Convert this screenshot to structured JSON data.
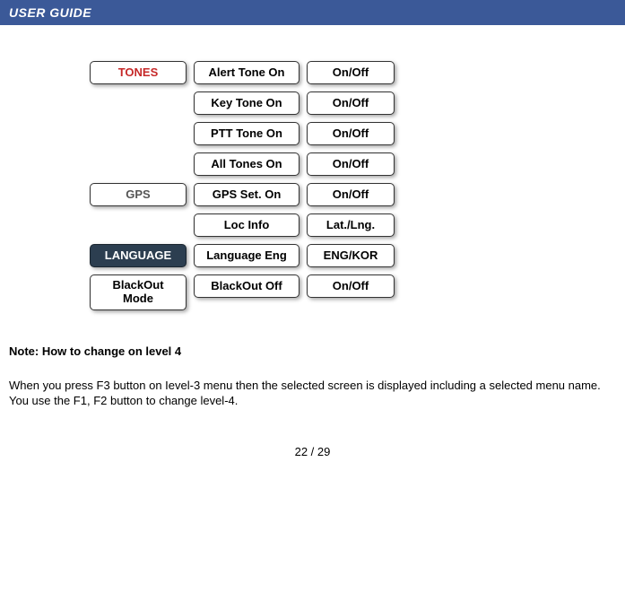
{
  "header": {
    "title": "USER GUIDE"
  },
  "menu": {
    "categories": {
      "tones": "TONES",
      "gps": "GPS",
      "language": "LANGUAGE",
      "blackout": "BlackOut Mode"
    },
    "rows": [
      {
        "setting": "Alert Tone On",
        "value": "On/Off"
      },
      {
        "setting": "Key Tone On",
        "value": "On/Off"
      },
      {
        "setting": "PTT Tone On",
        "value": "On/Off"
      },
      {
        "setting": "All Tones On",
        "value": "On/Off"
      },
      {
        "setting": "GPS Set.  On",
        "value": "On/Off"
      },
      {
        "setting": "Loc Info",
        "value": "Lat./Lng."
      },
      {
        "setting": "Language Eng",
        "value": "ENG/KOR"
      },
      {
        "setting": "BlackOut  Off",
        "value": "On/Off"
      }
    ]
  },
  "note": {
    "heading": "Note: How to change on level 4",
    "body": "When you press F3 button on Ievel-3 menu then the selected screen is displayed including a selected menu name. You use the F1, F2 button to change level-4."
  },
  "footer": {
    "page": "22 / 29"
  }
}
